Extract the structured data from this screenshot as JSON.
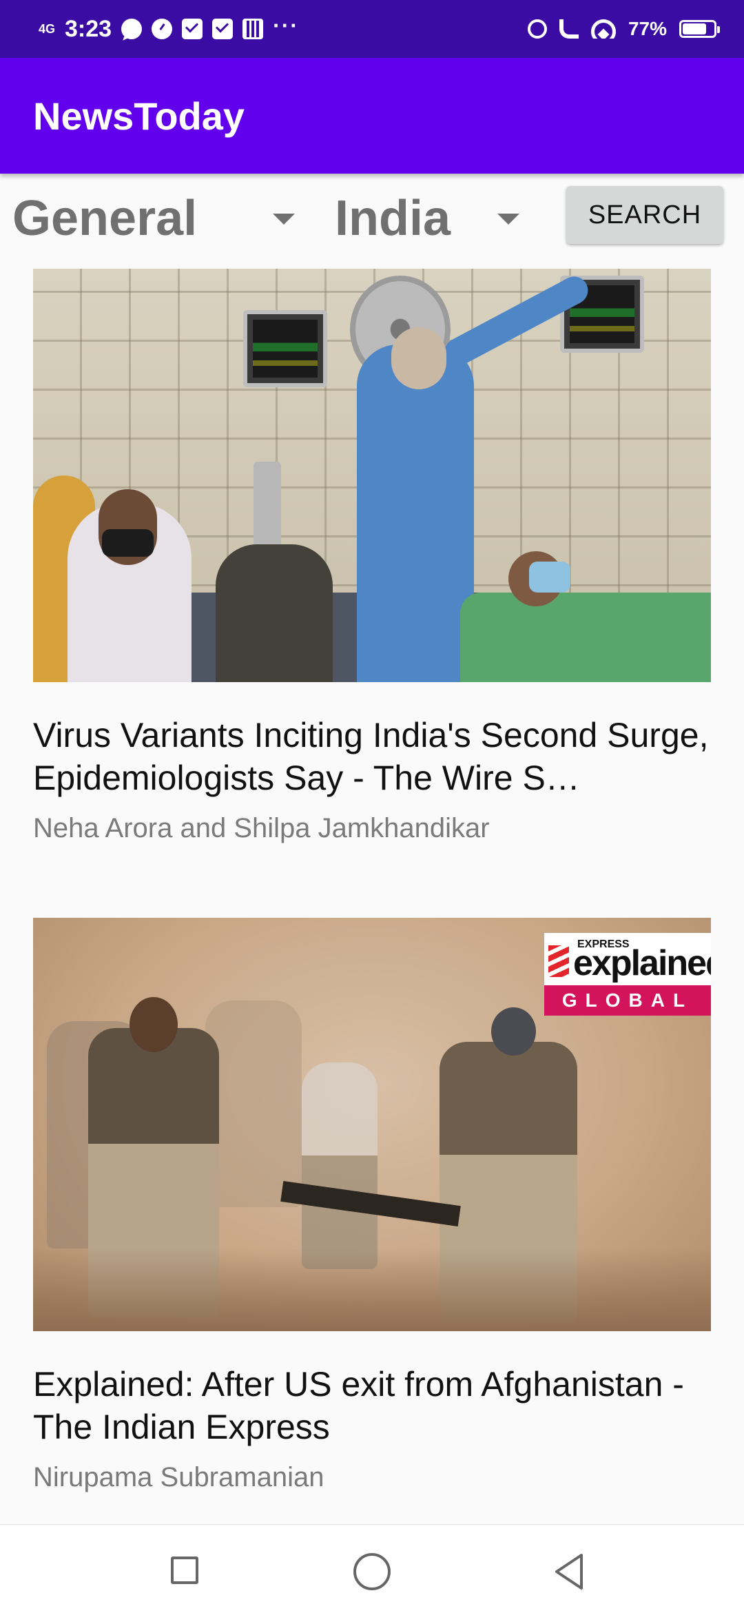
{
  "status_bar": {
    "network": "4G",
    "time": "3:23",
    "more": "···",
    "battery_percent": "77%",
    "battery_level": 0.77,
    "icons": [
      "chat-icon",
      "clock-icon",
      "mail-icon",
      "mail-icon",
      "calendar-icon",
      "alarm-icon",
      "wifi-call-icon",
      "wifi-icon",
      "battery-icon"
    ]
  },
  "app_bar": {
    "title": "NewsToday",
    "color": "#6200ee"
  },
  "filters": {
    "category": "General",
    "country": "India",
    "search_label": "SEARCH"
  },
  "articles": [
    {
      "headline": "Virus Variants Inciting India's Second Surge, Epidemiologists Say - The Wire S…",
      "author": "Neha Arora and Shilpa Jamkhandikar"
    },
    {
      "headline": "Explained: After US exit from Afghanistan - The Indian Express",
      "author": "Nirupama Subramanian",
      "badge": {
        "top": "EXPRESS",
        "main": "explained",
        "bottom": "GLOBAL"
      }
    }
  ],
  "nav_bar": {
    "icons": [
      "recents-icon",
      "home-icon",
      "back-icon"
    ]
  }
}
